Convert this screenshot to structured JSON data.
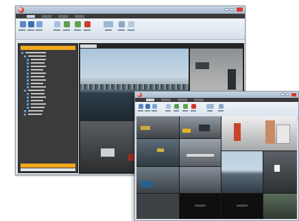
{
  "back_window": {
    "title": "",
    "tabs": [
      "",
      "",
      "",
      ""
    ],
    "tree_items": 24
  },
  "front_window": {
    "title": "",
    "tabs": [
      "",
      "",
      "",
      ""
    ]
  },
  "colors": {
    "accent": "#f2a81d",
    "titlebar": "#a7bbd0",
    "dark_panel": "#3b3b3b",
    "close": "#d33c2c"
  },
  "icons": [
    "app-orb-icon",
    "close-icon",
    "minimize-icon",
    "maximize-icon"
  ]
}
